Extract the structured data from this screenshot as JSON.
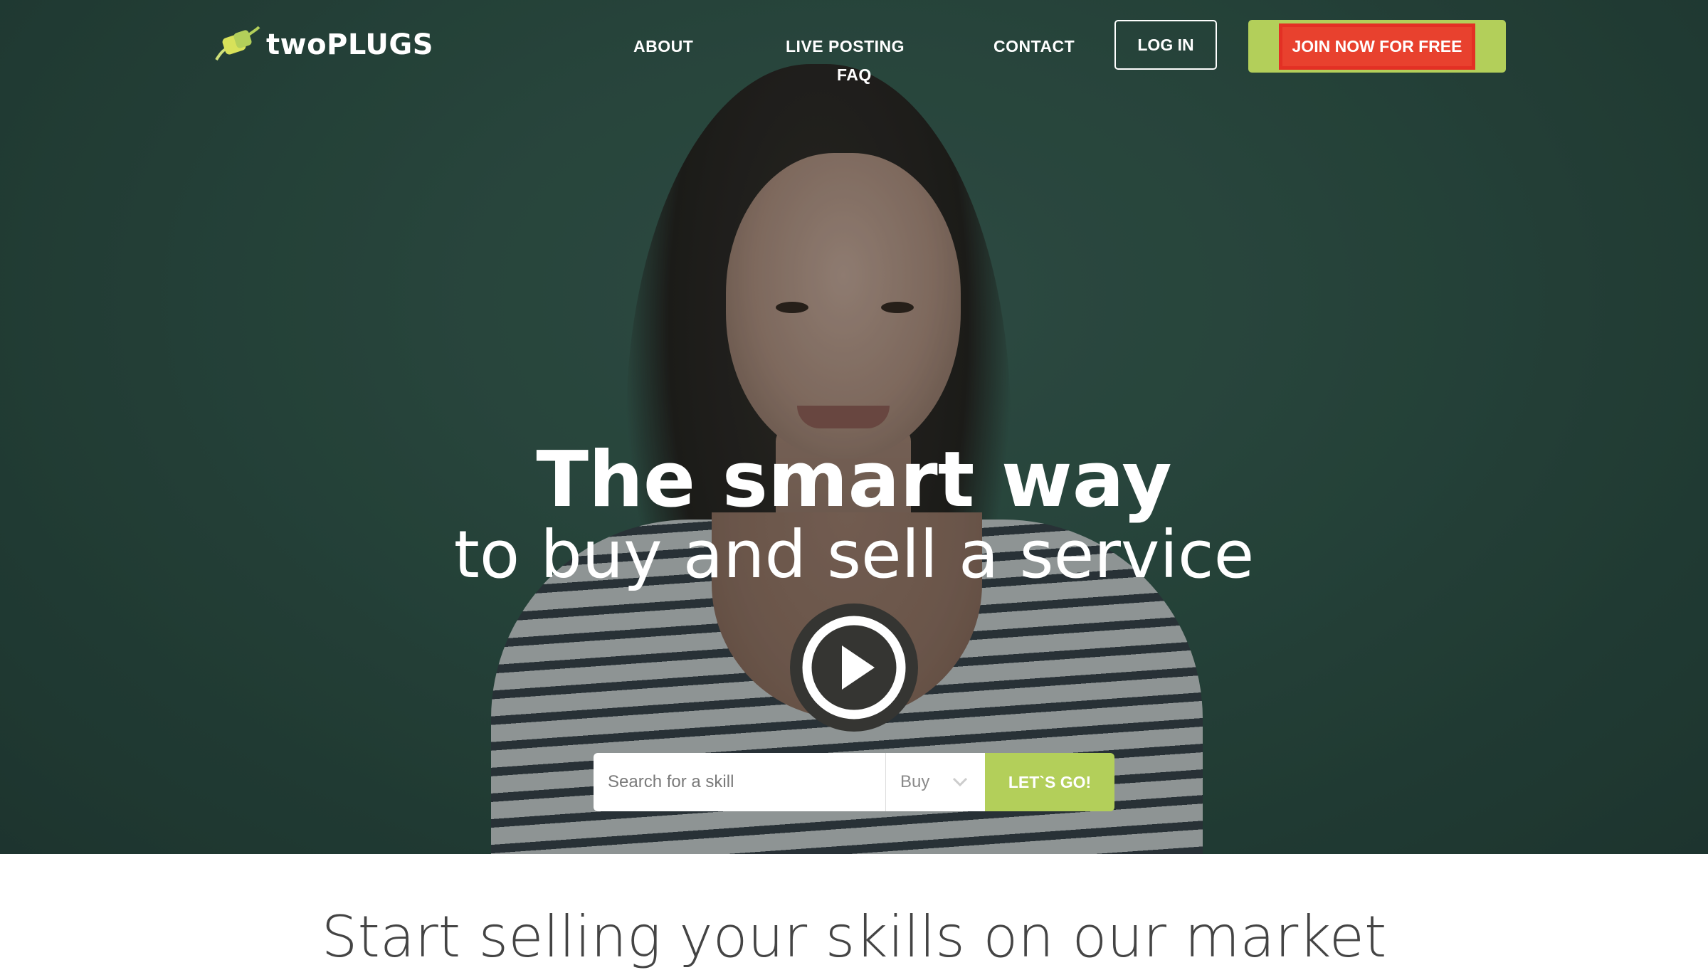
{
  "brand": {
    "name": "twoPLUGS",
    "accent": "#b3cf5a",
    "highlight": "#e8412e"
  },
  "nav": {
    "items": [
      {
        "label": "ABOUT"
      },
      {
        "label": "LIVE POSTING"
      },
      {
        "label": "FAQ"
      },
      {
        "label": "CONTACT"
      }
    ],
    "login": "LOG IN",
    "join": "JOIN NOW FOR FREE"
  },
  "hero": {
    "title": "The smart way",
    "subtitle": "to buy and sell a service",
    "play_icon": "play-icon"
  },
  "search": {
    "placeholder": "Search for a skill",
    "mode_selected": "Buy",
    "submit": "LET`S GO!"
  },
  "below_fold": {
    "heading_partial": "Start selling your skills on our market"
  }
}
